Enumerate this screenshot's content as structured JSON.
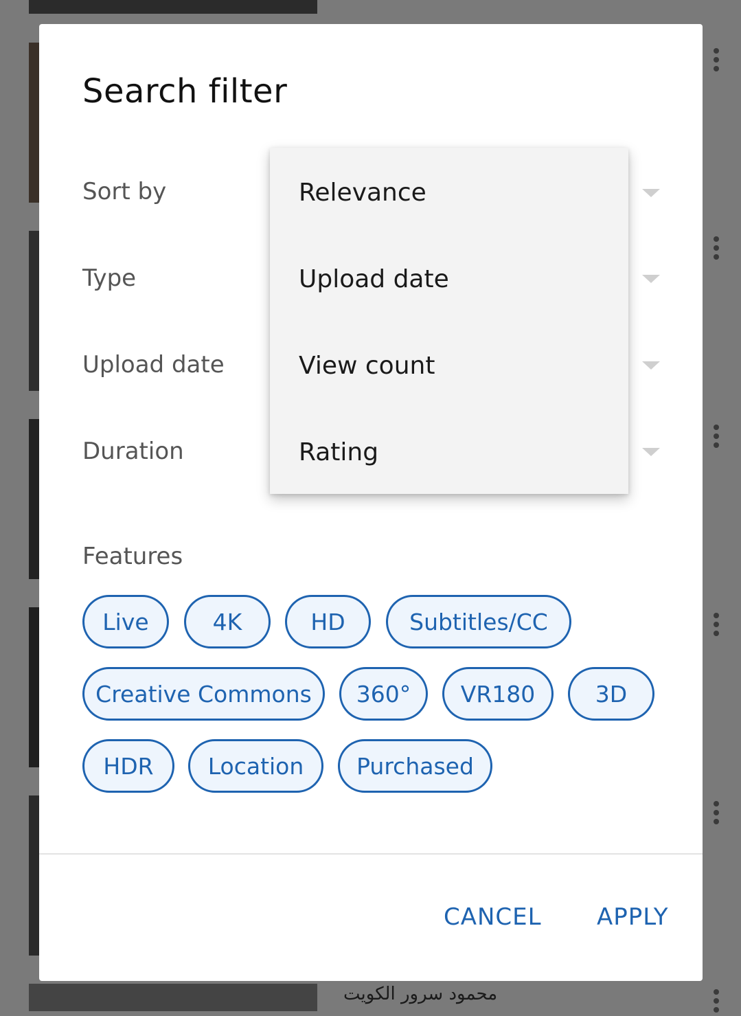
{
  "dialog": {
    "title": "Search filter",
    "rows": [
      {
        "label": "Sort by"
      },
      {
        "label": "Type"
      },
      {
        "label": "Upload date"
      },
      {
        "label": "Duration"
      }
    ],
    "features_label": "Features",
    "chips": [
      "Live",
      "4K",
      "HD",
      "Subtitles/CC",
      "Creative Commons",
      "360°",
      "VR180",
      "3D",
      "HDR",
      "Location",
      "Purchased"
    ],
    "cancel_label": "CANCEL",
    "apply_label": "APPLY"
  },
  "sort_dropdown": {
    "options": [
      "Relevance",
      "Upload date",
      "View count",
      "Rating"
    ]
  },
  "background": {
    "video_title_partial": "محمود سرور الكويت"
  },
  "colors": {
    "accent": "#1e63b0",
    "chip_fill": "#eef5fd",
    "scrim": "#7a7a7a"
  }
}
